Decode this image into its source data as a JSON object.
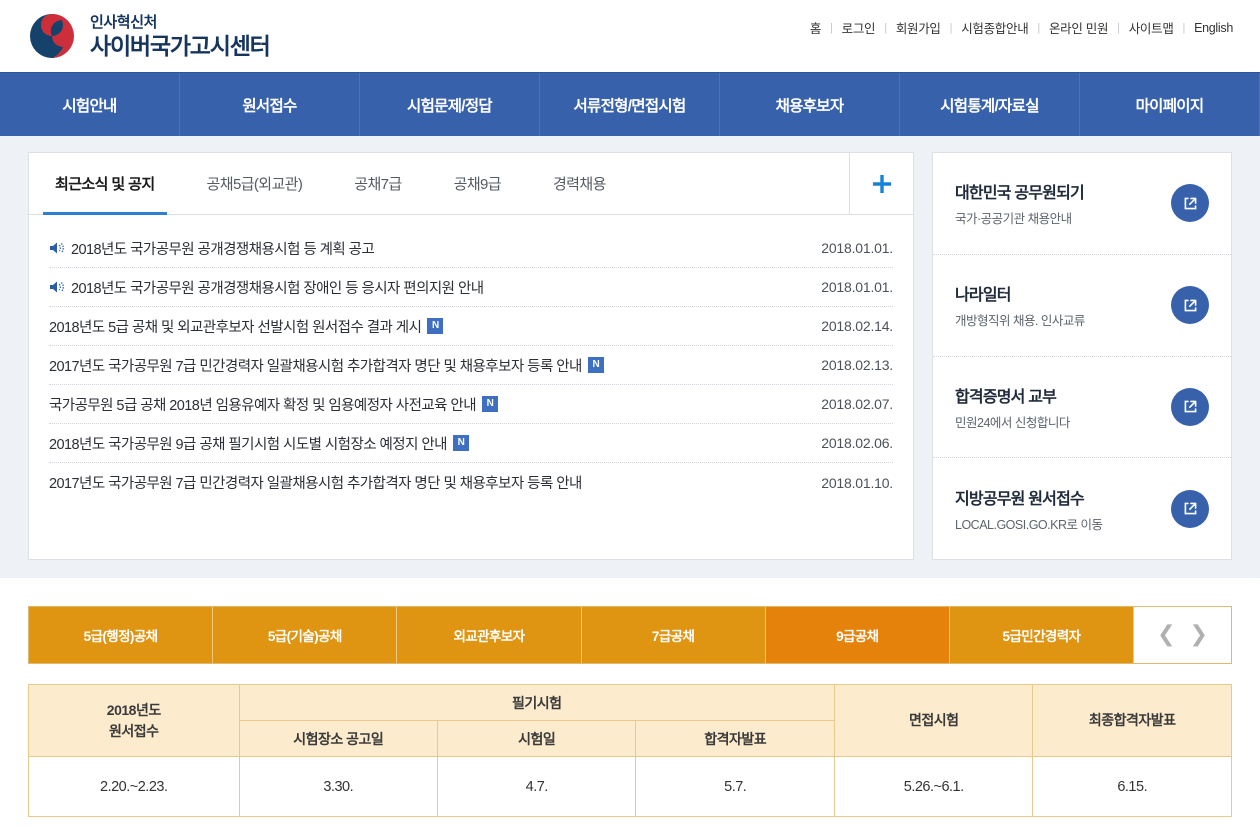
{
  "header": {
    "logo_icon": "korea-government-taegeuk-logo",
    "agency_name": "인사혁신처",
    "site_name": "사이버국가고시센터",
    "util_nav": [
      {
        "label": "홈"
      },
      {
        "label": "로그인"
      },
      {
        "label": "회원가입"
      },
      {
        "label": "시험종합안내"
      },
      {
        "label": "온라인 민원"
      },
      {
        "label": "사이트맵"
      },
      {
        "label": "English"
      }
    ]
  },
  "gnb": {
    "items": [
      {
        "label": "시험안내"
      },
      {
        "label": "원서접수"
      },
      {
        "label": "시험문제/정답"
      },
      {
        "label": "서류전형/면접시험"
      },
      {
        "label": "채용후보자"
      },
      {
        "label": "시험통계/자료실"
      },
      {
        "label": "마이페이지"
      }
    ]
  },
  "news": {
    "tabs": [
      {
        "label": "최근소식 및 공지",
        "active": true
      },
      {
        "label": "공채5급(외교관)",
        "active": false
      },
      {
        "label": "공채7급",
        "active": false
      },
      {
        "label": "공채9급",
        "active": false
      },
      {
        "label": "경력채용",
        "active": false
      }
    ],
    "add_icon": "plus-icon",
    "items": [
      {
        "icon": "speaker-icon",
        "title": "2018년도 국가공무원 공개경쟁채용시험 등 계획 공고",
        "badge": "",
        "date": "2018.01.01."
      },
      {
        "icon": "speaker-icon",
        "title": "2018년도 국가공무원 공개경쟁채용시험 장애인 등 응시자 편의지원 안내",
        "badge": "",
        "date": "2018.01.01."
      },
      {
        "icon": "",
        "title": "2018년도 5급 공채 및 외교관후보자 선발시험 원서접수 결과 게시",
        "badge": "N",
        "date": "2018.02.14."
      },
      {
        "icon": "",
        "title": "2017년도 국가공무원 7급 민간경력자 일괄채용시험 추가합격자 명단 및 채용후보자 등록 안내",
        "badge": "N",
        "date": "2018.02.13."
      },
      {
        "icon": "",
        "title": "국가공무원 5급 공채 2018년 임용유예자 확정 및 임용예정자 사전교육 안내",
        "badge": "N",
        "date": "2018.02.07."
      },
      {
        "icon": "",
        "title": "2018년도 국가공무원 9급 공채 필기시험 시도별 시험장소 예정지 안내",
        "badge": "N",
        "date": "2018.02.06."
      },
      {
        "icon": "",
        "title": "2017년도 국가공무원 7급 민간경력자 일괄채용시험 추가합격자 명단 및 채용후보자 등록 안내",
        "badge": "",
        "date": "2018.01.10."
      }
    ]
  },
  "quick_links": {
    "items": [
      {
        "title": "대한민국 공무원되기",
        "sub": "국가·공공기관 채용안내",
        "icon": "external-link-icon"
      },
      {
        "title": "나라일터",
        "sub": "개방형직위 채용. 인사교류",
        "icon": "external-link-icon"
      },
      {
        "title": "합격증명서 교부",
        "sub": "민원24에서 신청합니다",
        "icon": "external-link-icon"
      },
      {
        "title": "지방공무원 원서접수",
        "sub": "LOCAL.GOSI.GO.KR로 이동",
        "icon": "external-link-icon"
      }
    ]
  },
  "schedule": {
    "tabs": [
      {
        "label": "5급(행정)공채",
        "active": false
      },
      {
        "label": "5급(기술)공채",
        "active": false
      },
      {
        "label": "외교관후보자",
        "active": false
      },
      {
        "label": "7급공채",
        "active": false
      },
      {
        "label": "9급공채",
        "active": true
      },
      {
        "label": "5급민간경력자",
        "active": false
      }
    ],
    "prev_icon": "chevron-left-icon",
    "next_icon": "chevron-right-icon",
    "table": {
      "headers": {
        "application": "2018년도\n원서접수",
        "written_exam_group": "필기시험",
        "venue_notice": "시험장소 공고일",
        "exam_date": "시험일",
        "pass_announce": "합격자발표",
        "interview": "면접시험",
        "final_announce": "최종합격자발표"
      },
      "row": {
        "application": "2.20.~2.23.",
        "venue_notice": "3.30.",
        "exam_date": "4.7.",
        "pass_announce": "5.7.",
        "interview": "5.26.~6.1.",
        "final_announce": "6.15."
      }
    }
  },
  "colors": {
    "nav_blue": "#3761ab",
    "brand_navy": "#16355e",
    "brand_red": "#cd2e3a",
    "accent_blue": "#2e7fd4",
    "tab_orange": "#df9412",
    "tab_orange_active": "#e5820b",
    "table_header": "#fcebcd",
    "zone_bg": "#eef1f5"
  }
}
